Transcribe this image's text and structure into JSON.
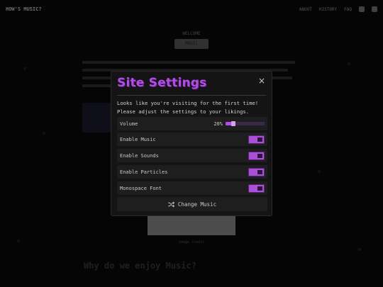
{
  "background": {
    "logo": "HOW'S MUSIC?",
    "nav_links": [
      "ABOUT",
      "HISTORY",
      "FAQ"
    ],
    "hero_subtitle": "WELCOME",
    "hero_title": "MUSIC",
    "caption": "image credit",
    "section_heading": "Why do we enjoy Music?"
  },
  "modal": {
    "title": "Site Settings",
    "close_label": "×",
    "intro_line1": "Looks like you're visiting for the first time!",
    "intro_line2": "Please adjust the settings to your likings.",
    "volume": {
      "label": "Volume",
      "value_text": "20%",
      "fraction": 0.2
    },
    "toggles": [
      {
        "label": "Enable Music",
        "on": true
      },
      {
        "label": "Enable Sounds",
        "on": true
      },
      {
        "label": "Enable Particles",
        "on": true
      },
      {
        "label": "Monospace Font",
        "on": true
      }
    ],
    "change_music_label": "Change Music",
    "accent_color": "#b14ee8"
  }
}
